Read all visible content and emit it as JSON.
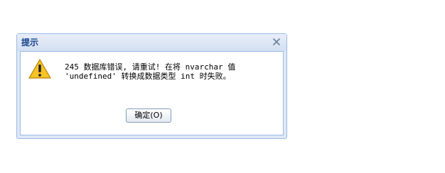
{
  "dialog": {
    "title": "提示",
    "close_glyph": "✕",
    "message_line1": "245 数据库错误, 请重试! 在将 nvarchar 值",
    "message_line2": "'undefined' 转换成数据类型 int 时失败。",
    "ok_label": "确定(O)",
    "icon": "warning-icon"
  },
  "colors": {
    "title_text": "#15428b",
    "border": "#99bbe8",
    "frame_bg": "#dfe8f6",
    "warning_fill": "#f7c325",
    "warning_stroke": "#b38500"
  }
}
